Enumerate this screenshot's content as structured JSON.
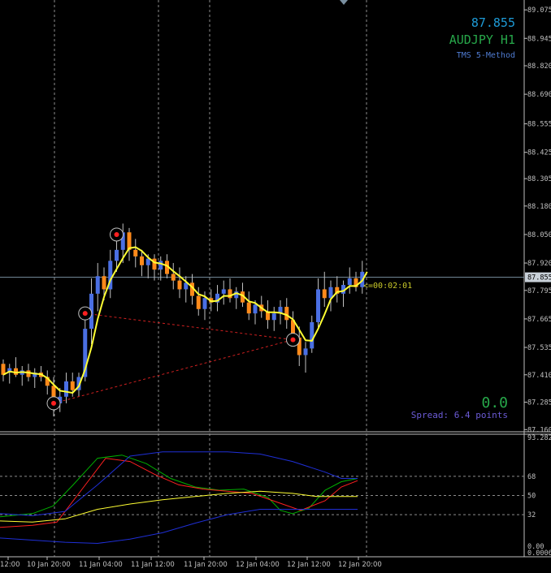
{
  "header": {
    "price": "87.855",
    "symbol": "AUDJPY H1",
    "indicator": "TMS 5-Method"
  },
  "current_price_label": "87.855",
  "countdown": "<=00:02:01",
  "info": {
    "value": "0.0",
    "spread": "Spread: 6.4 points"
  },
  "colors": {
    "background": "#000000",
    "bull_candle": "#4a6fe3",
    "bear_candle": "#ff8a1a",
    "ma_line": "#ffff33",
    "grid": "#8c8c8c",
    "price_text": "#1e9bd7",
    "symbol_text": "#27a84a",
    "indicator_text": "#4f7bd1",
    "spread_text": "#6b5bd6",
    "countdown_text": "#c9c92a",
    "rsi_green": "#00b000",
    "rsi_red": "#ff2020",
    "rsi_yellow": "#ffff33",
    "band_blue": "#1f2fd6"
  },
  "price_axis": {
    "labels": [
      "89.075",
      "88.945",
      "88.820",
      "88.690",
      "88.555",
      "88.425",
      "88.305",
      "88.180",
      "88.050",
      "87.920",
      "87.795",
      "87.665",
      "87.535",
      "87.410",
      "87.285",
      "87.160"
    ]
  },
  "sub_axis": {
    "labels": [
      "93.282",
      "68",
      "50",
      "32",
      "0.00",
      "0.00069"
    ]
  },
  "time_axis": {
    "labels": [
      "12:00",
      "10 Jan 20:00",
      "11 Jan 04:00",
      "11 Jan 12:00",
      "11 Jan 20:00",
      "12 Jan 04:00",
      "12 Jan 12:00",
      "12 Jan 20:00"
    ]
  },
  "chart_data": {
    "type": "candlestick",
    "symbol": "AUDJPY",
    "timeframe": "H1",
    "ylim": [
      87.15,
      89.12
    ],
    "candles": [
      [
        87.46,
        87.48,
        87.38,
        87.41
      ],
      [
        87.42,
        87.46,
        87.37,
        87.44
      ],
      [
        87.44,
        87.49,
        87.4,
        87.41
      ],
      [
        87.41,
        87.45,
        87.36,
        87.43
      ],
      [
        87.43,
        87.46,
        87.38,
        87.4
      ],
      [
        87.4,
        87.44,
        87.35,
        87.42
      ],
      [
        87.42,
        87.45,
        87.38,
        87.4
      ],
      [
        87.4,
        87.43,
        87.32,
        87.36
      ],
      [
        87.36,
        87.4,
        87.22,
        87.28
      ],
      [
        87.28,
        87.35,
        87.24,
        87.31
      ],
      [
        87.31,
        87.42,
        87.28,
        87.38
      ],
      [
        87.38,
        87.42,
        87.31,
        87.34
      ],
      [
        87.34,
        87.42,
        87.31,
        87.4
      ],
      [
        87.4,
        87.7,
        87.38,
        87.62
      ],
      [
        87.62,
        87.85,
        87.55,
        87.78
      ],
      [
        87.78,
        87.92,
        87.7,
        87.86
      ],
      [
        87.86,
        87.9,
        87.75,
        87.8
      ],
      [
        87.8,
        87.98,
        87.76,
        87.93
      ],
      [
        87.93,
        88.05,
        87.88,
        87.98
      ],
      [
        87.98,
        88.1,
        87.92,
        88.06
      ],
      [
        88.06,
        88.08,
        87.93,
        87.98
      ],
      [
        87.98,
        88.03,
        87.9,
        87.95
      ],
      [
        87.95,
        87.98,
        87.86,
        87.91
      ],
      [
        87.91,
        87.96,
        87.85,
        87.94
      ],
      [
        87.94,
        87.96,
        87.84,
        87.89
      ],
      [
        87.89,
        87.95,
        87.84,
        87.93
      ],
      [
        87.93,
        87.96,
        87.85,
        87.87
      ],
      [
        87.87,
        87.92,
        87.8,
        87.84
      ],
      [
        87.84,
        87.9,
        87.76,
        87.8
      ],
      [
        87.8,
        87.86,
        87.74,
        87.83
      ],
      [
        87.83,
        87.87,
        87.73,
        87.77
      ],
      [
        87.77,
        87.81,
        87.68,
        87.71
      ],
      [
        87.71,
        87.79,
        87.66,
        87.76
      ],
      [
        87.76,
        87.8,
        87.7,
        87.74
      ],
      [
        87.74,
        87.82,
        87.7,
        87.78
      ],
      [
        87.78,
        87.84,
        87.73,
        87.8
      ],
      [
        87.8,
        87.85,
        87.74,
        87.76
      ],
      [
        87.76,
        87.81,
        87.71,
        87.79
      ],
      [
        87.79,
        87.83,
        87.72,
        87.74
      ],
      [
        87.74,
        87.79,
        87.66,
        87.69
      ],
      [
        87.69,
        87.75,
        87.64,
        87.73
      ],
      [
        87.73,
        87.77,
        87.67,
        87.7
      ],
      [
        87.7,
        87.75,
        87.62,
        87.66
      ],
      [
        87.66,
        87.72,
        87.61,
        87.69
      ],
      [
        87.69,
        87.75,
        87.64,
        87.72
      ],
      [
        87.72,
        87.76,
        87.62,
        87.66
      ],
      [
        87.66,
        87.7,
        87.55,
        87.58
      ],
      [
        87.58,
        87.63,
        87.45,
        87.5
      ],
      [
        87.5,
        87.56,
        87.42,
        87.53
      ],
      [
        87.53,
        87.68,
        87.51,
        87.65
      ],
      [
        87.65,
        87.85,
        87.62,
        87.8
      ],
      [
        87.8,
        87.88,
        87.72,
        87.76
      ],
      [
        87.76,
        87.84,
        87.7,
        87.81
      ],
      [
        87.81,
        87.86,
        87.74,
        87.78
      ],
      [
        87.78,
        87.84,
        87.72,
        87.82
      ],
      [
        87.82,
        87.9,
        87.78,
        87.85
      ],
      [
        87.85,
        87.88,
        87.79,
        87.81
      ],
      [
        87.81,
        87.93,
        87.78,
        87.88
      ]
    ],
    "markers": [
      {
        "bar": 8,
        "price": 87.28,
        "label": "low arrow"
      },
      {
        "bar": 13,
        "price": 87.69,
        "label": "sell arrow"
      },
      {
        "bar": 18,
        "price": 88.05,
        "label": "top arrow"
      },
      {
        "bar": 46,
        "price": 87.57,
        "label": "buy arrow"
      }
    ]
  }
}
